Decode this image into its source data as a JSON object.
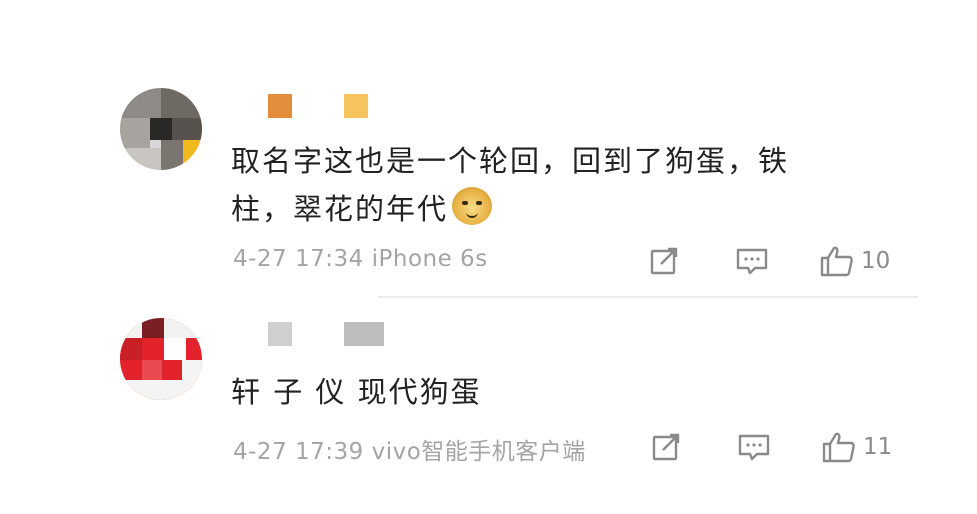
{
  "colors": {
    "text": "#222222",
    "meta": "#a4a4a4",
    "icon": "#8a8a8a",
    "divider": "#ececec"
  },
  "comments": [
    {
      "avatar_icon": "pixelated-avatar",
      "username_pixels": [
        "#e38d3b",
        "#f5c45d"
      ],
      "text_line1": "取名字这也是一个轮回，回到了狗蛋，铁",
      "text_line2": "柱，翠花的年代",
      "emoji_icon": "doge-emoji",
      "timestamp": "4-27 17:34",
      "device": "iPhone 6s",
      "share_icon": "share-icon",
      "reply_icon": "comment-icon",
      "like_icon": "thumbs-up-icon",
      "like_count": "10"
    },
    {
      "avatar_icon": "pixelated-avatar",
      "username_pixels": [
        "#cfcfcf",
        "#bdbdbd"
      ],
      "text_line1": "轩 子 仪 现代狗蛋",
      "timestamp": "4-27 17:39",
      "device": "vivo智能手机客户端",
      "share_icon": "share-icon",
      "reply_icon": "comment-icon",
      "like_icon": "thumbs-up-icon",
      "like_count": "11"
    }
  ]
}
